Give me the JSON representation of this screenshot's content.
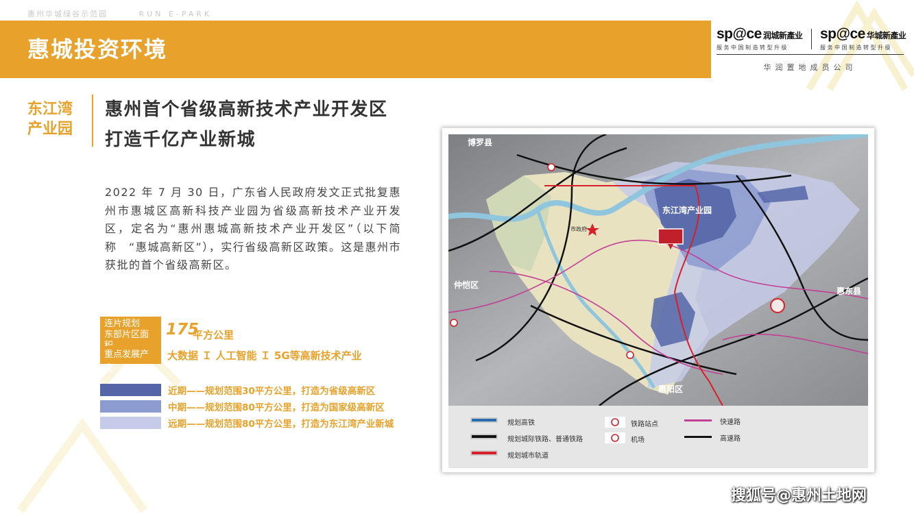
{
  "top_bar": {
    "project_name": "惠州华城绿谷示范园",
    "english_name": "RUN E-PARK"
  },
  "header": {
    "title": "惠城投资环境"
  },
  "brands": [
    {
      "logo": "sp@ce",
      "name": "润城新產业",
      "tagline": "服务中国制造转型升级"
    },
    {
      "logo": "sp@ce",
      "name": "华城新產业",
      "tagline": "服务中国制造转型升级"
    }
  ],
  "member_text": "华润置地成员公司",
  "section": {
    "label_line1": "东江湾",
    "label_line2": "产业园"
  },
  "headline": {
    "line1": "惠州首个省级高新技术产业开发区",
    "line2": "打造千亿产业新城"
  },
  "paragraph": "2022 年 7 月 30 日，广东省人民政府发文正式批复惠州市惠城区高新科技产业园为省级高新技术产业开发区，定名为“惠州惠城高新技术产业开发区”（以下简称　“惠城高新区”），实行省级高新区政策。这是惠州市获批的首个省级高新区。",
  "stats": {
    "area_label_line1": "连片规划",
    "area_label_line2": "东部片区面积",
    "area_value": "175",
    "area_unit": "平方公里",
    "industry_label": "重点发展产业",
    "industries": "大数据 Ｉ 人工智能 Ｉ 5G等高新技术产业"
  },
  "phases": [
    {
      "text": "近期——规划范围30平方公里，打造为省级高新区",
      "color": "#5466a8"
    },
    {
      "text": "中期——规划范围80平方公里，打造为国家级高新区",
      "color": "#8c9bd0"
    },
    {
      "text": "远期——规划范围80平方公里，打造为东江湾产业新城",
      "color": "#c5cbe8"
    }
  ],
  "map": {
    "labels": {
      "boluo": "博罗县",
      "park": "东江湾产业园",
      "zhongkai": "仲恺区",
      "huidong": "惠东县",
      "huiyang": "惠阳区",
      "gov": "市政府"
    },
    "legend": {
      "hsr": "规划高铁",
      "intercity": "规划城际铁路、普通铁路",
      "metro": "规划城市轨道",
      "station": "铁路站点",
      "airport": "机场",
      "expressway_fast": "快速路",
      "expressway": "高速路"
    }
  },
  "watermark": "搜狐号@惠州土地网"
}
